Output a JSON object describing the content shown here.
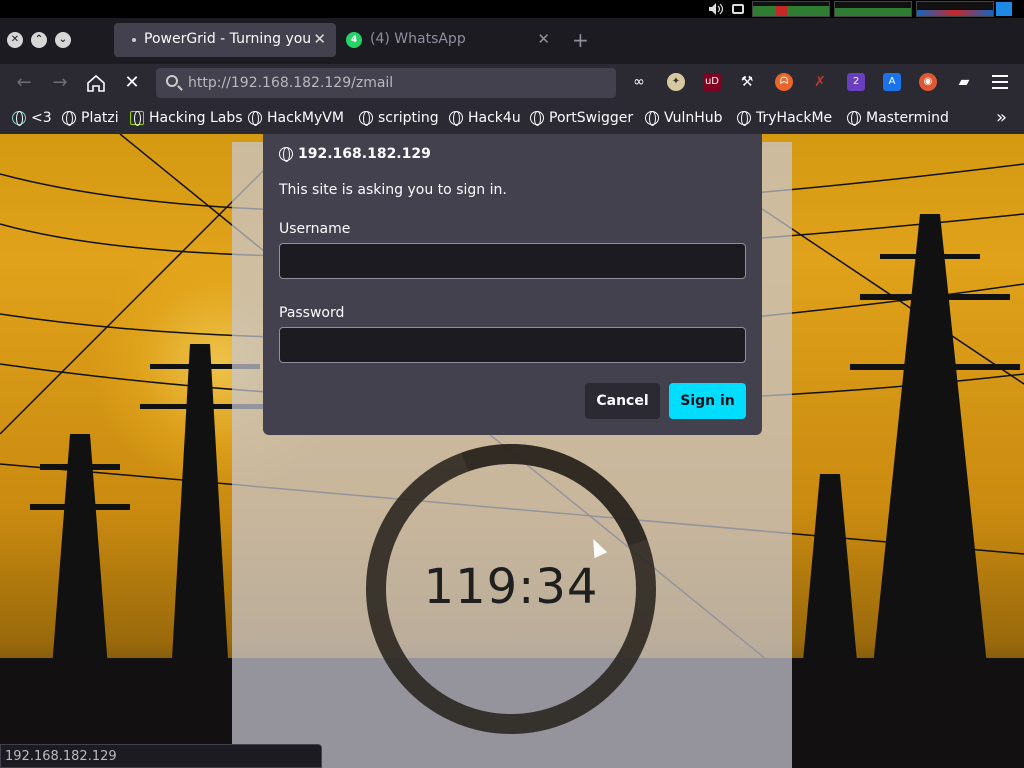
{
  "tabs": [
    {
      "title": "PowerGrid - Turning your",
      "active": true
    },
    {
      "title": "(4) WhatsApp",
      "active": false,
      "badge": "4"
    }
  ],
  "nav": {
    "url": "http://192.168.182.129/zmail"
  },
  "extensions": [
    {
      "name": "mask-icon"
    },
    {
      "name": "compass-icon"
    },
    {
      "name": "ublock-icon",
      "label": "uD"
    },
    {
      "name": "wrench-icon"
    },
    {
      "name": "fox-icon"
    },
    {
      "name": "pen-off-icon"
    },
    {
      "name": "shield-badge-icon",
      "badge": "2"
    },
    {
      "name": "translate-icon"
    },
    {
      "name": "duckduckgo-icon"
    },
    {
      "name": "hat-icon"
    }
  ],
  "bookmarks": [
    {
      "label": "<3",
      "icon": "openai-icon"
    },
    {
      "label": "Platzi",
      "icon": "globe-icon"
    },
    {
      "label": "Hacking Labs",
      "icon": "cube-icon"
    },
    {
      "label": "HackMyVM",
      "icon": "globe-icon"
    },
    {
      "label": "scripting",
      "icon": "globe-icon"
    },
    {
      "label": "Hack4u",
      "icon": "globe-icon"
    },
    {
      "label": "PortSwigger",
      "icon": "globe-icon"
    },
    {
      "label": "VulnHub",
      "icon": "globe-icon"
    },
    {
      "label": "TryHackMe",
      "icon": "globe-icon"
    },
    {
      "label": "Mastermind",
      "icon": "globe-icon"
    }
  ],
  "dialog": {
    "host": "192.168.182.129",
    "message": "This site is asking you to sign in.",
    "username_label": "Username",
    "username_value": "",
    "password_label": "Password",
    "password_value": "",
    "cancel_label": "Cancel",
    "signin_label": "Sign in"
  },
  "page": {
    "timer": "119:34"
  },
  "status": {
    "text": "192.168.182.129"
  },
  "colors": {
    "accent": "#00ddff",
    "dialog_bg": "#42414d",
    "toolbar_bg": "#2b2a33"
  }
}
